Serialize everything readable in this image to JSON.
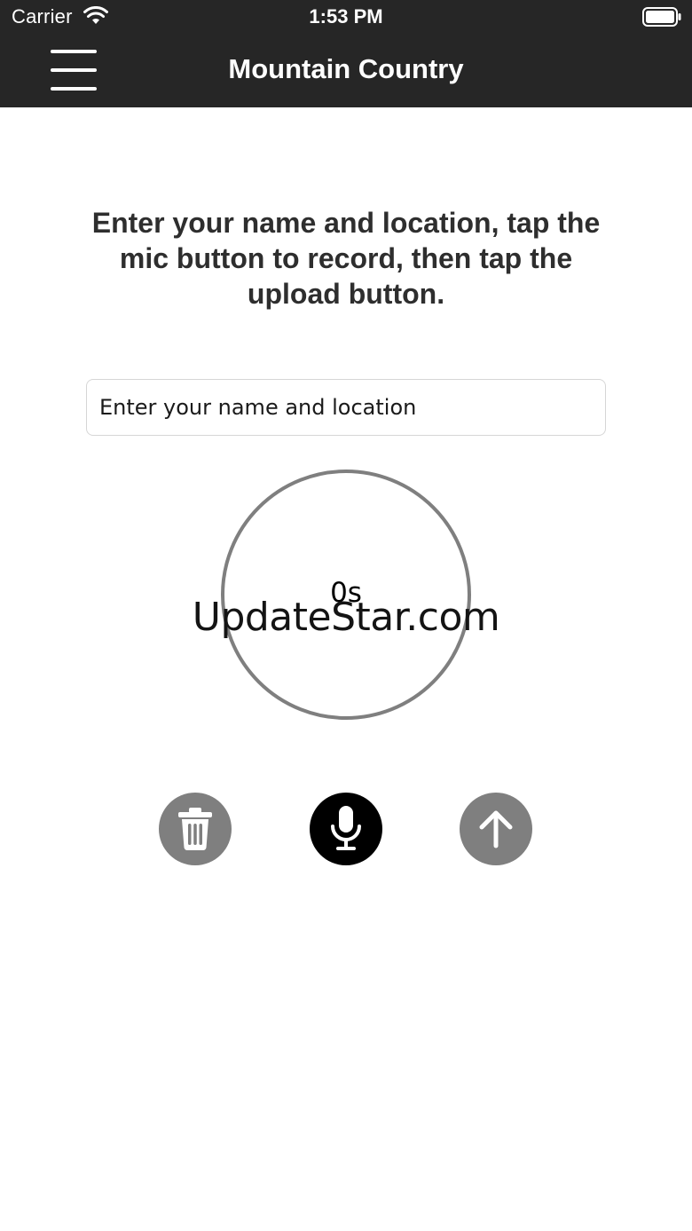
{
  "status_bar": {
    "carrier": "Carrier",
    "time": "1:53 PM",
    "wifi_icon": "wifi-icon",
    "battery_icon": "battery-icon"
  },
  "nav": {
    "title": "Mountain Country",
    "menu_icon": "hamburger-menu-icon"
  },
  "instructions": "Enter your name and location, tap the mic button to record, then tap the upload button.",
  "name_input": {
    "placeholder": "Enter your name and location",
    "value": ""
  },
  "timer": {
    "label": "0s"
  },
  "watermark": "UpdateStar.com",
  "controls": {
    "delete_icon": "trash-icon",
    "record_icon": "microphone-icon",
    "upload_icon": "arrow-up-icon"
  },
  "colors": {
    "header_bg": "#262626",
    "header_text": "#ffffff",
    "body_text": "#2e2e2e",
    "inactive_button": "#7f7f7f",
    "active_button": "#000000",
    "ring": "#7f7f7f"
  }
}
